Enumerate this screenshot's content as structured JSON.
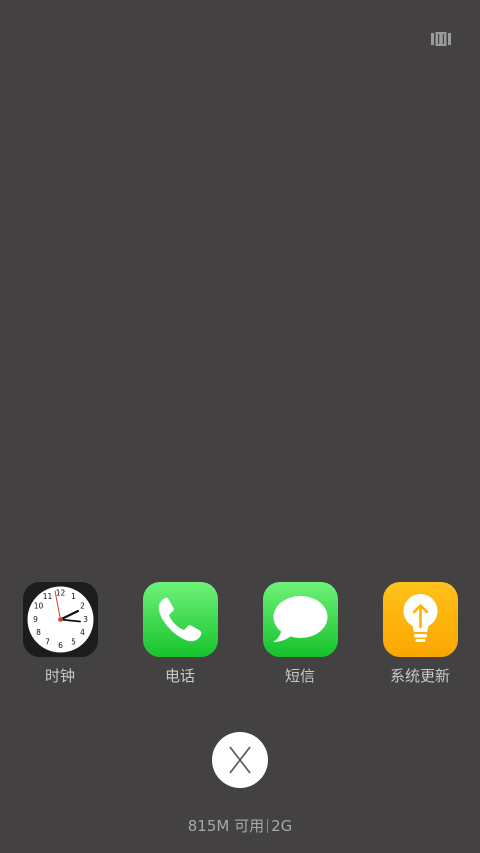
{
  "top_bar": {
    "layout_icon": "card-layout-icon"
  },
  "recent_apps": [
    {
      "label": "时钟",
      "icon": "clock-icon"
    },
    {
      "label": "电话",
      "icon": "phone-icon"
    },
    {
      "label": "短信",
      "icon": "messages-icon"
    },
    {
      "label": "系统更新",
      "icon": "system-update-icon"
    }
  ],
  "close_button": {
    "icon": "close-x-icon"
  },
  "memory": {
    "free": "815M 可用",
    "total": "2G"
  },
  "colors": {
    "background": "#434142",
    "phone_green": "#3cd54c",
    "messages_green": "#3dd34d",
    "update_orange": "#fbb304",
    "label_gray": "#c9c9c9"
  }
}
